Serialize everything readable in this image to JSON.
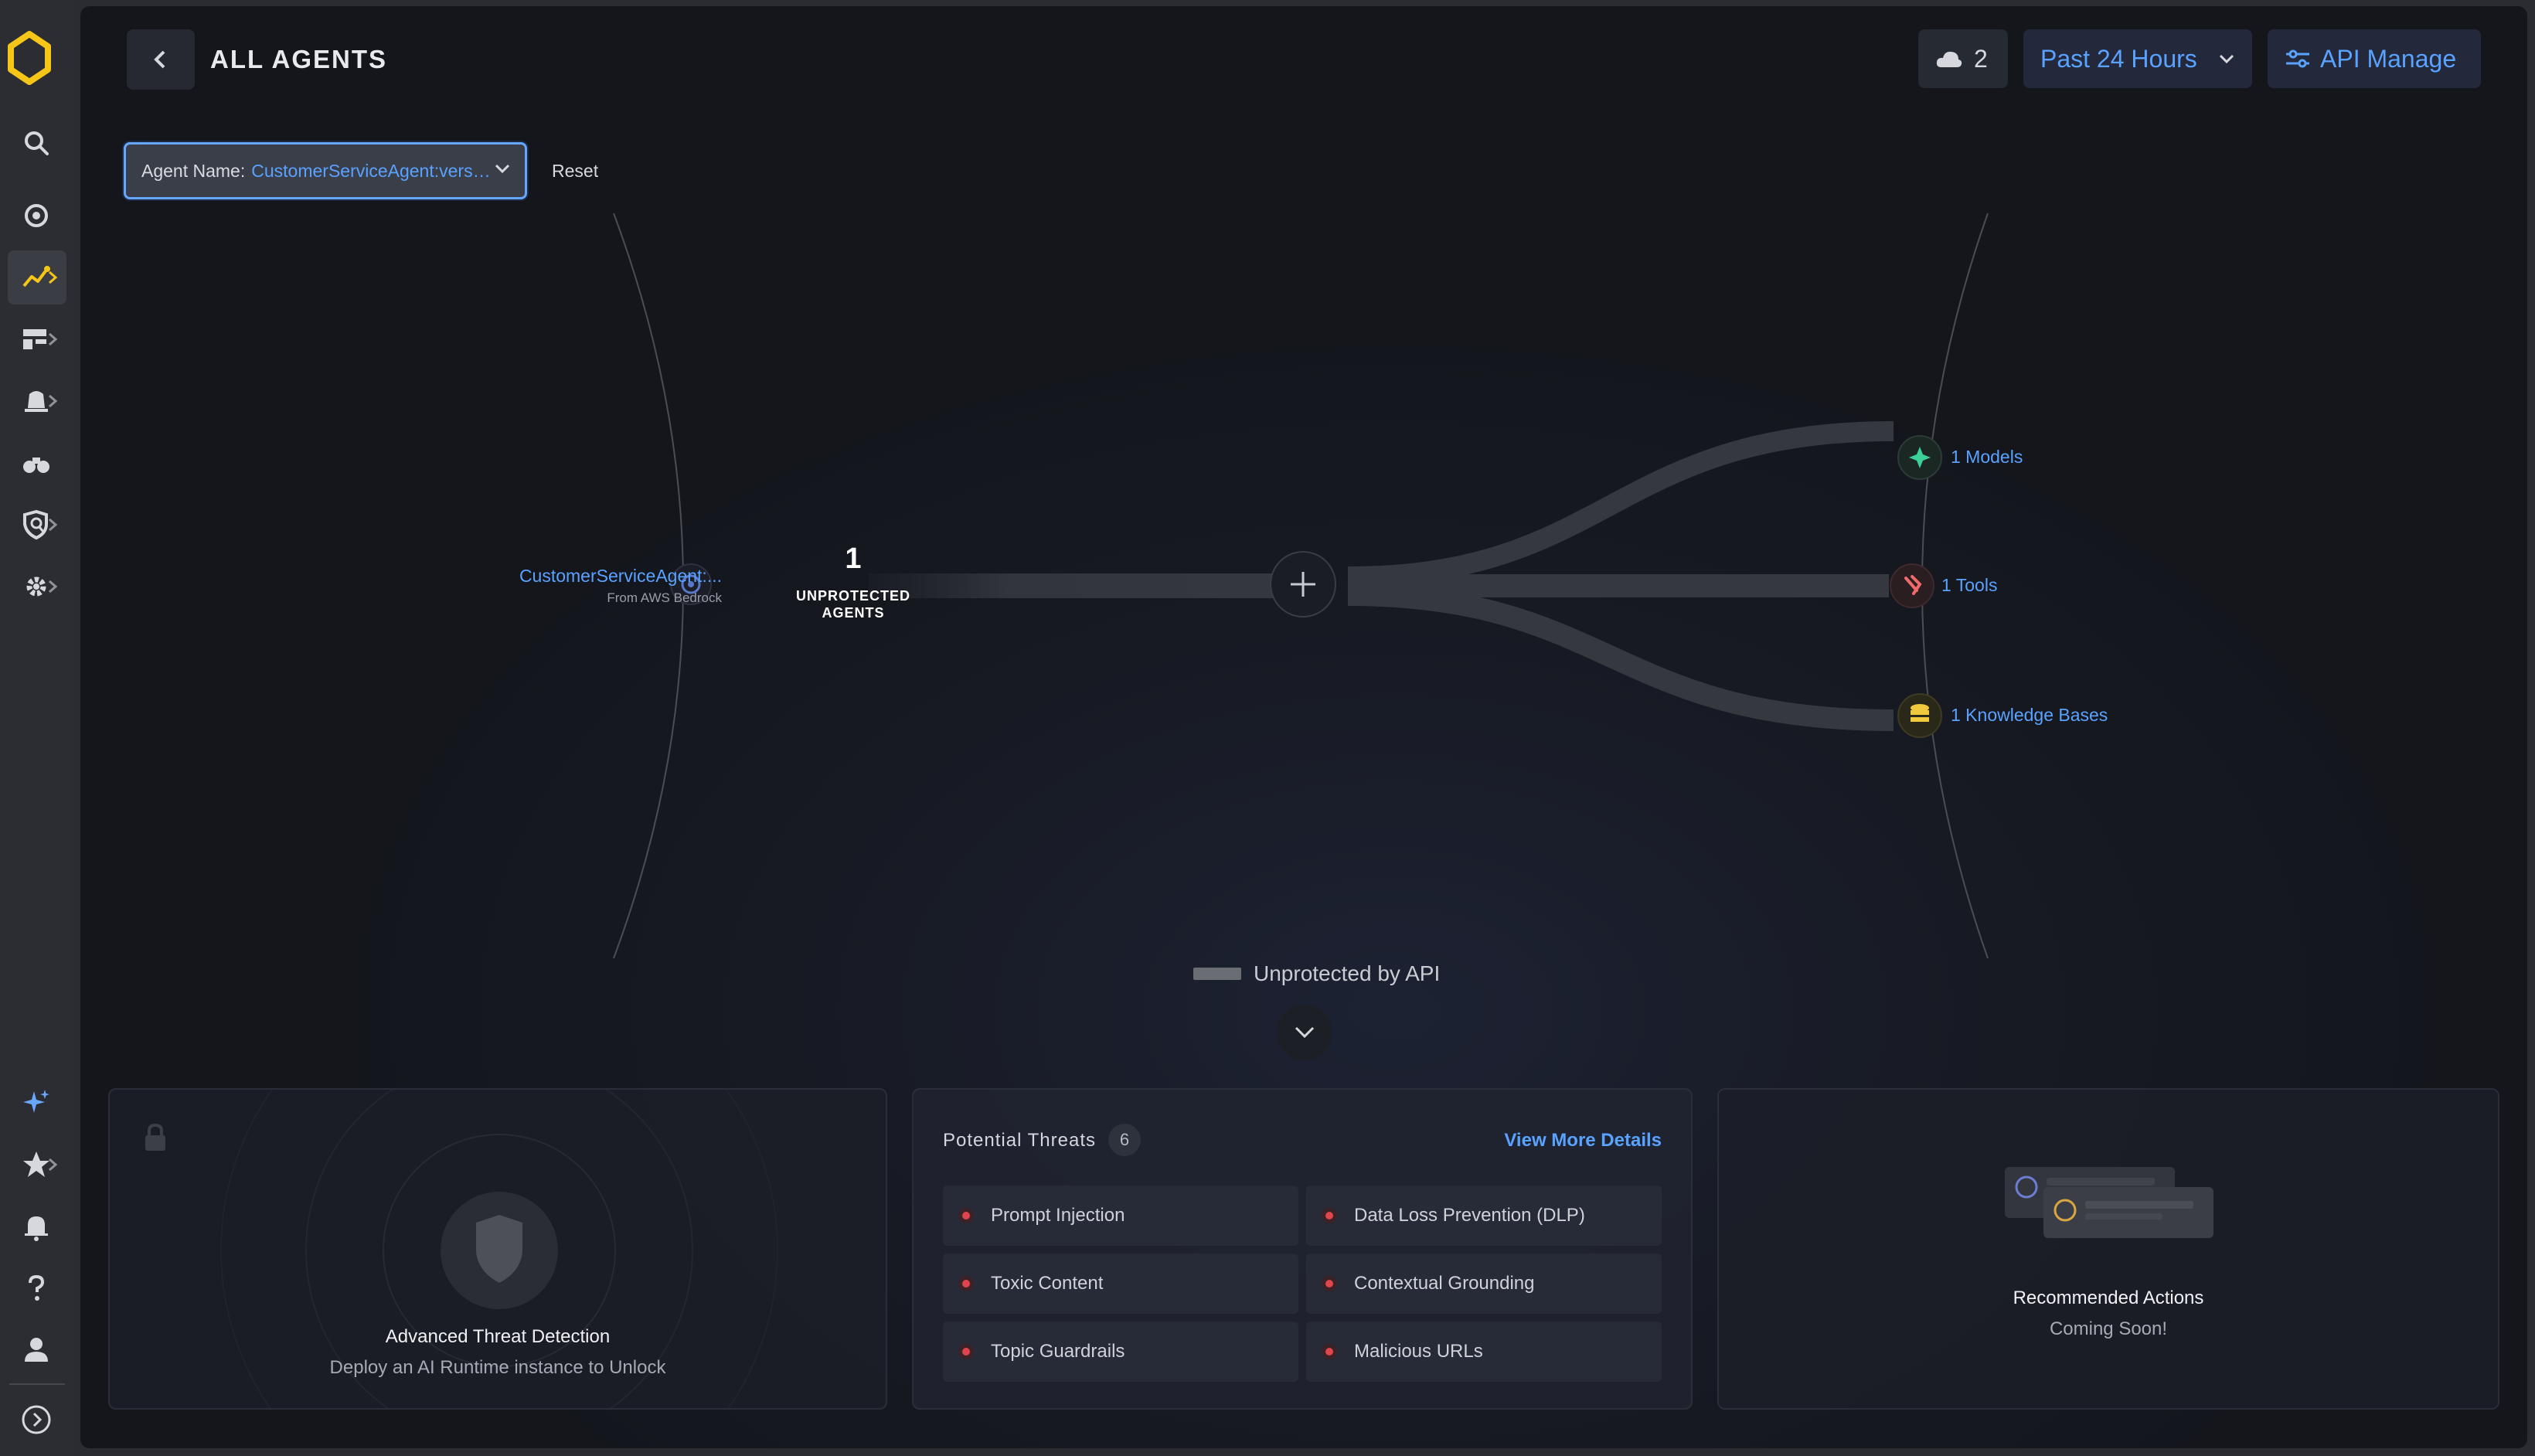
{
  "header": {
    "title": "ALL AGENTS",
    "cloud_count": "2",
    "time_range": "Past 24 Hours",
    "api_manage": "API Manage"
  },
  "filter": {
    "label": "Agent Name:",
    "value": "CustomerServiceAgent:versi...",
    "reset": "Reset"
  },
  "flow": {
    "agent_name": "CustomerServiceAgent:...",
    "agent_source": "From AWS Bedrock",
    "unprotected_count": "1",
    "unprotected_label_line1": "UNPROTECTED",
    "unprotected_label_line2": "AGENTS",
    "models": "1 Models",
    "tools": "1 Tools",
    "knowledge_bases": "1 Knowledge Bases",
    "legend": "Unprotected by API"
  },
  "cards": {
    "atd_title": "Advanced Threat Detection",
    "atd_subtitle": "Deploy an AI Runtime instance to Unlock",
    "threats_title": "Potential Threats",
    "threats_count": "6",
    "view_more": "View More Details",
    "threats": [
      "Prompt Injection",
      "Data Loss Prevention (DLP)",
      "Toxic Content",
      "Contextual Grounding",
      "Topic Guardrails",
      "Malicious URLs"
    ],
    "rec_title": "Recommended Actions",
    "rec_subtitle": "Coming Soon!"
  },
  "colors": {
    "accent": "#5aa2ff",
    "logo": "#f5c518",
    "threat_dot": "#e0444c"
  }
}
